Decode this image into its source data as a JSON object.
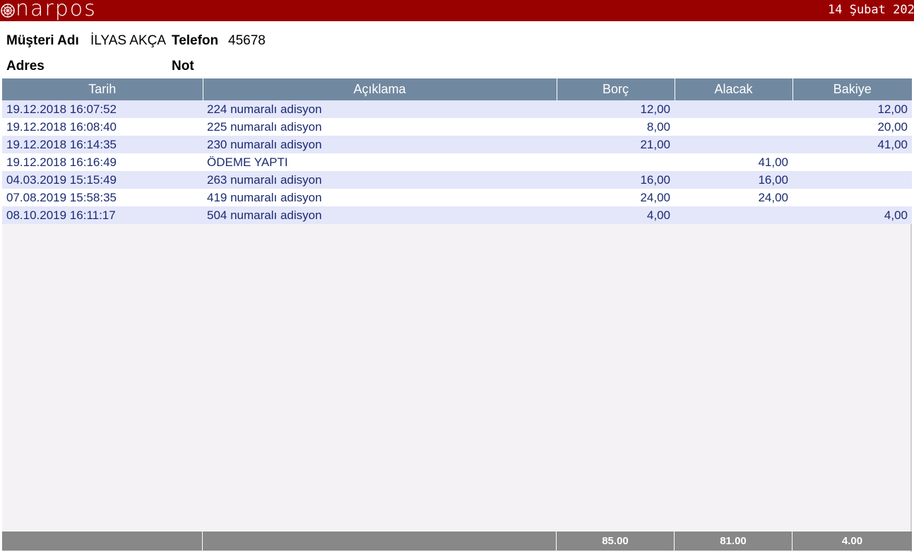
{
  "app": {
    "logo_text": "narpos",
    "date_text": "14 Şubat 202"
  },
  "customer": {
    "name_label": "Müşteri Adı",
    "name": "İLYAS AKÇA",
    "phone_label": "Telefon",
    "phone": "45678",
    "address_label": "Adres",
    "note_label": "Not"
  },
  "table": {
    "headers": [
      "Tarih",
      "Açıklama",
      "Borç",
      "Alacak",
      "Bakiye"
    ],
    "rows": [
      {
        "date": "19.12.2018 16:07:52",
        "desc": "224 numaralı adisyon",
        "debit": "12,00",
        "credit": "",
        "balance": "12,00"
      },
      {
        "date": "19.12.2018 16:08:40",
        "desc": "225 numaralı adisyon",
        "debit": "8,00",
        "credit": "",
        "balance": "20,00"
      },
      {
        "date": "19.12.2018 16:14:35",
        "desc": "230 numaralı adisyon",
        "debit": "21,00",
        "credit": "",
        "balance": "41,00"
      },
      {
        "date": "19.12.2018 16:16:49",
        "desc": "ÖDEME YAPTI",
        "debit": "",
        "credit": "41,00",
        "balance": ""
      },
      {
        "date": "04.03.2019 15:15:49",
        "desc": "263 numaralı adisyon",
        "debit": "16,00",
        "credit": "16,00",
        "balance": ""
      },
      {
        "date": "07.08.2019 15:58:35",
        "desc": "419 numaralı adisyon",
        "debit": "24,00",
        "credit": "24,00",
        "balance": ""
      },
      {
        "date": "08.10.2019 16:11:17",
        "desc": "504 numaralı adisyon",
        "debit": "4,00",
        "credit": "",
        "balance": "4,00"
      }
    ]
  },
  "totals": {
    "date": "",
    "desc": "",
    "debit": "85.00",
    "credit": "81.00",
    "balance": "4.00"
  },
  "colors": {
    "topbar": "#990000",
    "header": "#7189a0",
    "row_alt": "#e4e6fa",
    "row_text": "#1a2b72",
    "footer": "#888888"
  }
}
